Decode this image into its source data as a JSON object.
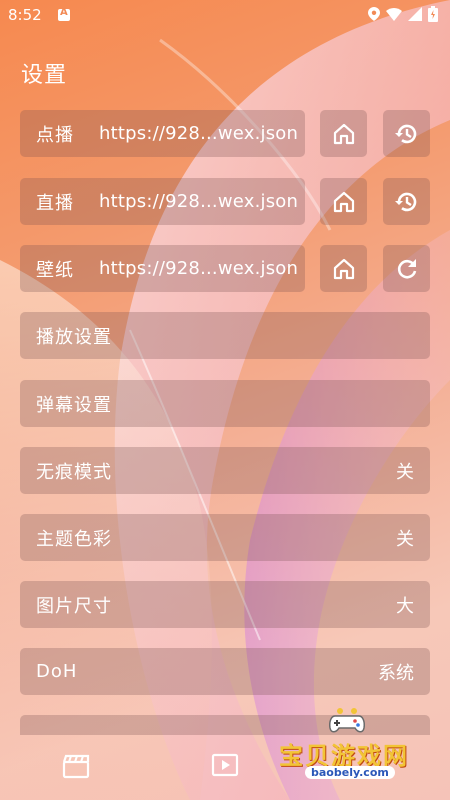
{
  "status_bar": {
    "time": "8:52"
  },
  "page": {
    "title": "设置"
  },
  "sources": [
    {
      "label": "点播",
      "url": "https://928...wex.json",
      "action_icon": "history-icon"
    },
    {
      "label": "直播",
      "url": "https://928...wex.json",
      "action_icon": "history-icon"
    },
    {
      "label": "壁纸",
      "url": "https://928...wex.json",
      "action_icon": "refresh-icon"
    }
  ],
  "settings": [
    {
      "label": "播放设置",
      "value": ""
    },
    {
      "label": "弹幕设置",
      "value": ""
    },
    {
      "label": "无痕模式",
      "value": "关"
    },
    {
      "label": "主题色彩",
      "value": "关"
    },
    {
      "label": "图片尺寸",
      "value": "大"
    },
    {
      "label": "DoH",
      "value": "系统"
    }
  ],
  "watermark": {
    "text": "宝贝游戏网",
    "url": "baobely.com"
  },
  "colors": {
    "background_top": "#f6894f",
    "background_bottom": "#f5c3b8",
    "watermark_text": "#f2c436",
    "watermark_url": "#2a57b8"
  }
}
